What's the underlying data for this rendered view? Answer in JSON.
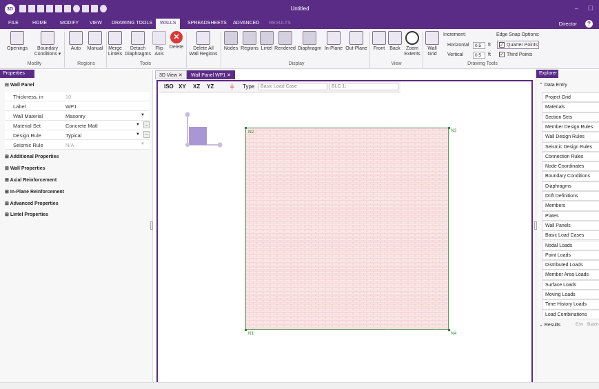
{
  "app": {
    "icon_text": "3D",
    "window_title": "Untitled",
    "user": "Director",
    "help": "?"
  },
  "menu_tabs": [
    "FILE",
    "HOME",
    "MODIFY",
    "VIEW",
    "DRAWING TOOLS",
    "WALLS",
    "SPREADSHEETS",
    "ADVANCED",
    "RESULTS"
  ],
  "ribbon": {
    "modify": {
      "group": "Modify",
      "openings": "Openings",
      "boundary1": "Boundary",
      "boundary2": "Conditions ▾"
    },
    "regions": {
      "group": "Regions",
      "auto": "Auto",
      "manual": "Manual"
    },
    "tools": {
      "group": "Tools",
      "merge1": "Merge",
      "merge2": "Lintels",
      "detach1": "Detach",
      "detach2": "Diaphragms",
      "flip1": "Flip",
      "flip2": "Axis",
      "delete": "Delete"
    },
    "delete_all": {
      "line1": "Delete All",
      "line2": "Wall Regions"
    },
    "display": {
      "group": "Display",
      "items": [
        "Nodes",
        "Regions",
        "Lintel",
        "Rendered",
        "Diaphragm",
        "In-Plane",
        "Out-Plane"
      ]
    },
    "view": {
      "group": "View",
      "front": "Front",
      "back": "Back",
      "zoom1": "Zoom",
      "zoom2": "Extents"
    },
    "drawing_tools": {
      "group": "Drawing Tools",
      "wall1": "Wall",
      "wall2": "Grid",
      "increment": "Increment:",
      "horizontal": "Horizontal",
      "vertical": "Vertical",
      "h_value": "0.5",
      "v_value": "0.5",
      "unit": "ft",
      "edge_snap": "Edge Snap Options:",
      "quarter": "Quarter Points",
      "third": "Third Points"
    }
  },
  "properties": {
    "header": "Properties",
    "wall_panel": "Wall Panel",
    "rows": [
      {
        "k": "Thickness, in",
        "v": "10",
        "dim": true
      },
      {
        "k": "Label",
        "v": "WP1"
      },
      {
        "k": "Wall Material",
        "v": "Masonry",
        "dd": true
      },
      {
        "k": "Material Set",
        "v": "Concrete Matl",
        "dd": true,
        "ell": true
      },
      {
        "k": "Design Rule",
        "v": "Typical",
        "dd": true,
        "ell": true
      },
      {
        "k": "Seismic Rule",
        "v": "N/A",
        "dim": true,
        "dd": true
      }
    ],
    "sections": [
      "Additional Properties",
      "Wall Properties",
      "Axial Reinforcement",
      "In-Plane Reinforcement",
      "Advanced Properties",
      "Lintel Properties"
    ]
  },
  "doc_tabs": {
    "tab1": "3D View",
    "tab2": "Wall Panel WP1"
  },
  "viewbar": {
    "iso": "ISO",
    "xy": "XY",
    "xz": "XZ",
    "yz": "YZ",
    "type_label": "Type",
    "type_value": "Basic Load Case",
    "blc_value": "BLC 1:"
  },
  "nodes": {
    "n1": "N1",
    "n2": "N2",
    "n3": "N3",
    "n4": "N4"
  },
  "explorer": {
    "header": "Explorer",
    "data_entry": "Data Entry",
    "items": [
      "Project Grid",
      "Materials",
      "Section Sets",
      "Member Design Rules",
      "Wall Design Rules",
      "Seismic Design Rules",
      "Connection Rules",
      "Node Coordinates",
      "Boundary Conditions",
      "Diaphragms",
      "Drift Definitions",
      "Members",
      "Plates",
      "Wall Panels",
      "Basic Load Cases",
      "Nodal Loads",
      "Point Loads",
      "Distributed Loads",
      "Member Area Loads",
      "Surface Loads",
      "Moving Loads",
      "Time History Loads",
      "Load Combinations"
    ],
    "results": "Results",
    "env": "Env",
    "batch": "Batch"
  },
  "colors": {
    "accent": "#5b2c86",
    "node": "#2e8b2e",
    "panel_fill": "#fbe8e8"
  }
}
